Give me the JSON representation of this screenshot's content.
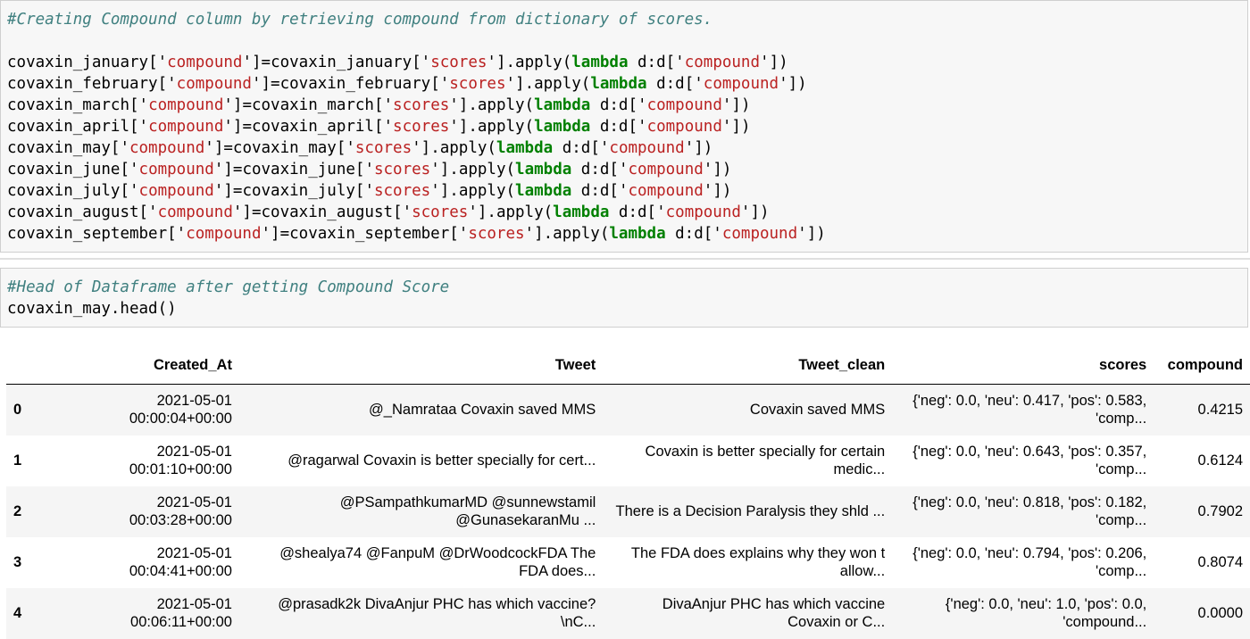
{
  "cell1": {
    "comment": "#Creating Compound column by retrieving compound from dictionary of scores.",
    "months": [
      "january",
      "february",
      "march",
      "april",
      "may",
      "june",
      "july",
      "august",
      "september"
    ],
    "var_prefix": "covaxin_",
    "key_open": "['",
    "key_close": "']",
    "target_key": "compound",
    "source_key": "scores",
    "apply_part": ".apply(",
    "lambda_kw": "lambda",
    "lambda_arg": " d:d[",
    "close_paren": "])"
  },
  "cell2": {
    "comment": "#Head of Dataframe after getting Compound Score",
    "code": "covaxin_may.head()"
  },
  "dataframe": {
    "columns": [
      "",
      "Created_At",
      "Tweet",
      "Tweet_clean",
      "scores",
      "compound"
    ],
    "rows": [
      {
        "index": "0",
        "date": "2021-05-01",
        "time": "00:00:04+00:00",
        "tweet1": "@_Namrataa Covaxin saved MMS",
        "tweet2": "",
        "clean1": "Covaxin saved MMS",
        "clean2": "",
        "scores1": "{'neg': 0.0, 'neu': 0.417, 'pos': 0.583,",
        "scores2": "'comp...",
        "compound": "0.4215"
      },
      {
        "index": "1",
        "date": "2021-05-01",
        "time": "00:01:10+00:00",
        "tweet1": "@ragarwal Covaxin is better specially for cert...",
        "tweet2": "",
        "clean1": "Covaxin is better specially for certain",
        "clean2": "medic...",
        "scores1": "{'neg': 0.0, 'neu': 0.643, 'pos': 0.357,",
        "scores2": "'comp...",
        "compound": "0.6124"
      },
      {
        "index": "2",
        "date": "2021-05-01",
        "time": "00:03:28+00:00",
        "tweet1": "@PSampathkumarMD @sunnewstamil",
        "tweet2": "@GunasekaranMu ...",
        "clean1": "There is a Decision Paralysis they shld ...",
        "clean2": "",
        "scores1": "{'neg': 0.0, 'neu': 0.818, 'pos': 0.182,",
        "scores2": "'comp...",
        "compound": "0.7902"
      },
      {
        "index": "3",
        "date": "2021-05-01",
        "time": "00:04:41+00:00",
        "tweet1": "@shealya74 @FanpuM @DrWoodcockFDA The",
        "tweet2": "FDA does...",
        "clean1": "The FDA does explains why they won t",
        "clean2": "allow...",
        "scores1": "{'neg': 0.0, 'neu': 0.794, 'pos': 0.206,",
        "scores2": "'comp...",
        "compound": "0.8074"
      },
      {
        "index": "4",
        "date": "2021-05-01",
        "time": "00:06:11+00:00",
        "tweet1": "@prasadk2k DivaAnjur PHC has which vaccine?",
        "tweet2": "\\nC...",
        "clean1": "DivaAnjur PHC has which vaccine",
        "clean2": "Covaxin or C...",
        "scores1": "{'neg': 0.0, 'neu': 1.0, 'pos': 0.0,",
        "scores2": "'compound...",
        "compound": "0.0000"
      }
    ]
  }
}
